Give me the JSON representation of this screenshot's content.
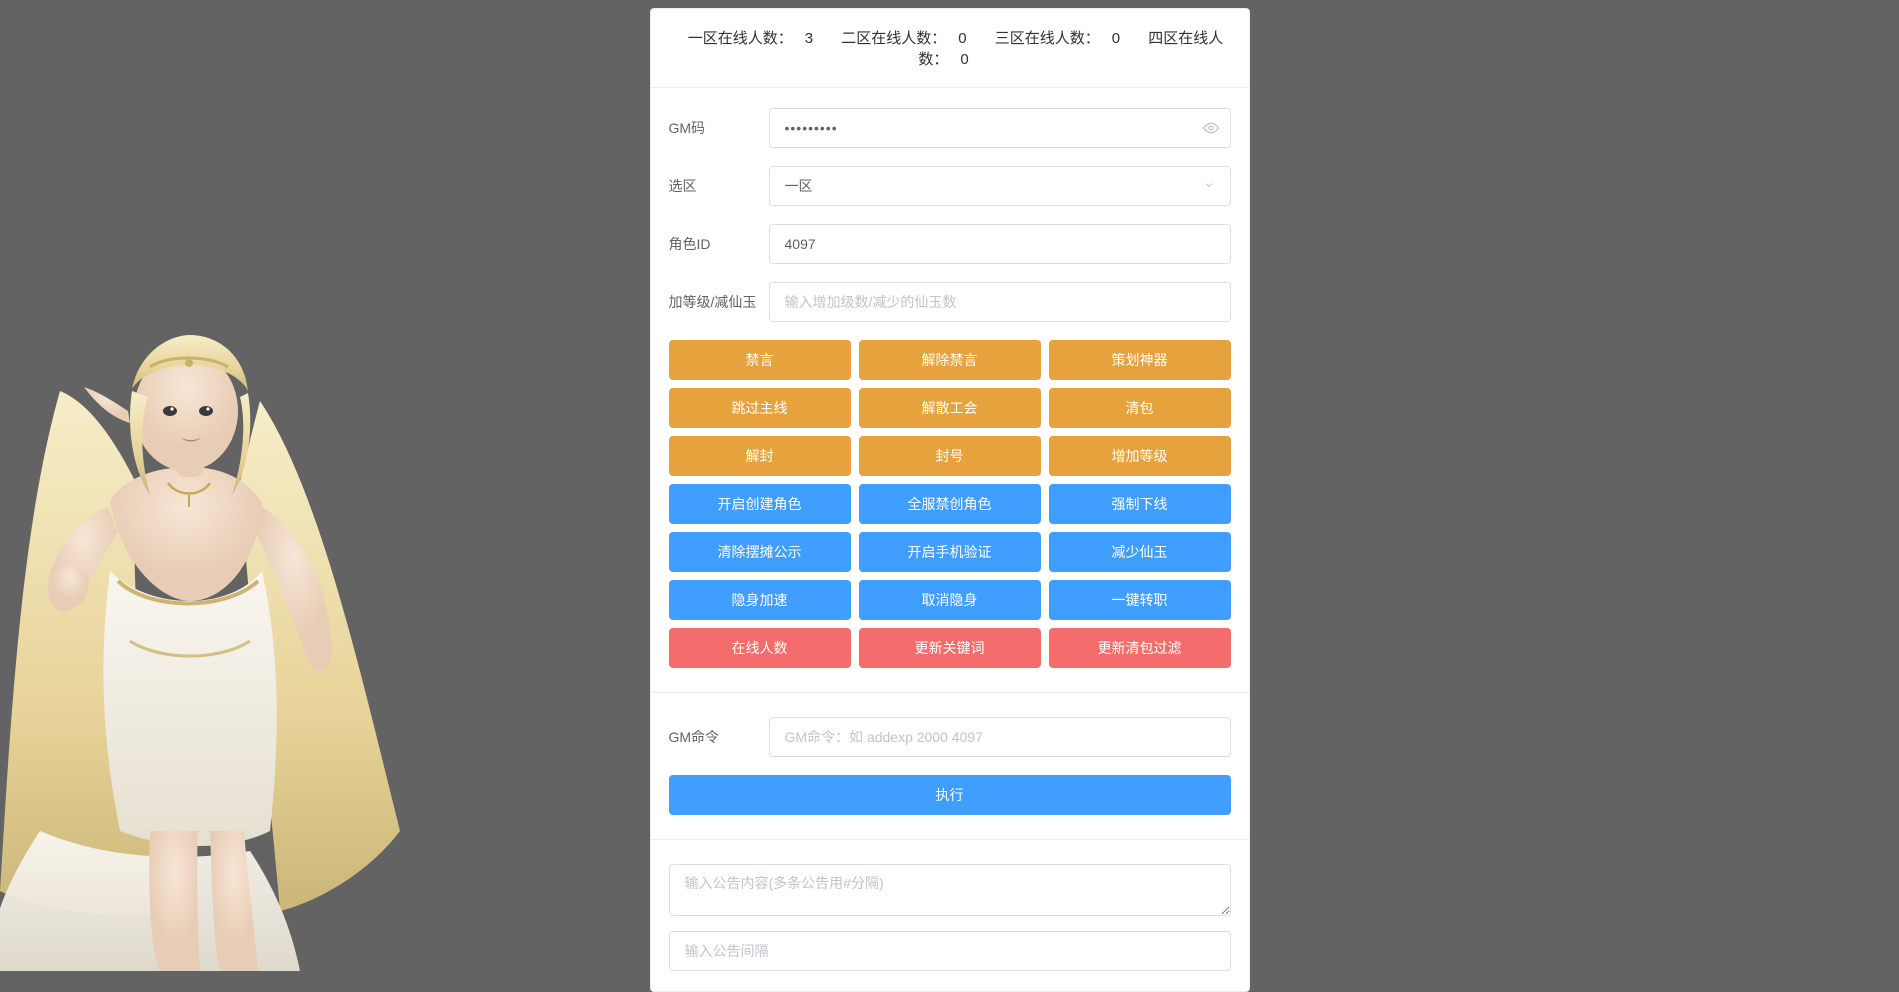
{
  "stats": {
    "s1_label": "一区在线人数：",
    "s1_val": "3",
    "s2_label": "二区在线人数：",
    "s2_val": "0",
    "s3_label": "三区在线人数：",
    "s3_val": "0",
    "s4_label": "四区在线人数：",
    "s4_val": "0"
  },
  "form": {
    "gm_code_label": "GM码",
    "gm_code_value": "•••••••••",
    "zone_label": "选区",
    "zone_selected": "一区",
    "role_id_label": "角色ID",
    "role_id_value": "4097",
    "level_label": "加等级/减仙玉",
    "level_placeholder": "输入增加级数/减少的仙玉数"
  },
  "buttons": {
    "warning": [
      "禁言",
      "解除禁言",
      "策划神器",
      "跳过主线",
      "解散工会",
      "清包",
      "解封",
      "封号",
      "增加等级"
    ],
    "primary": [
      "开启创建角色",
      "全服禁创角色",
      "强制下线",
      "清除摆摊公示",
      "开启手机验证",
      "减少仙玉",
      "隐身加速",
      "取消隐身",
      "一键转职"
    ],
    "danger": [
      "在线人数",
      "更新关键词",
      "更新清包过滤"
    ]
  },
  "cmd": {
    "label": "GM命令",
    "placeholder": "GM命令：如 addexp 2000 4097",
    "submit": "执行"
  },
  "announce": {
    "content_placeholder": "输入公告内容(多条公告用#分隔)",
    "interval_placeholder": "输入公告间隔"
  },
  "colors": {
    "warning": "#e6a23c",
    "primary": "#409eff",
    "danger": "#f56c6c"
  }
}
